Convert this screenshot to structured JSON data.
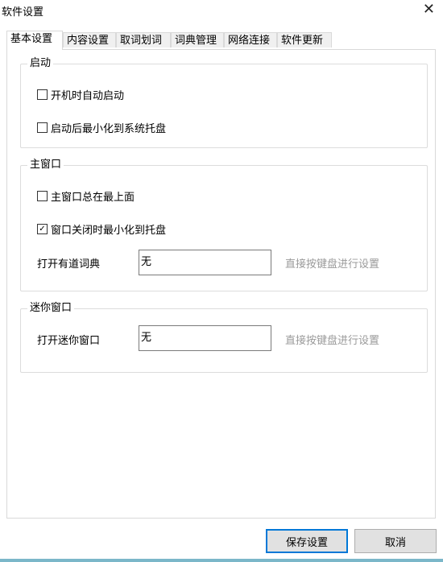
{
  "window": {
    "title": "软件设置"
  },
  "tabs": [
    {
      "label": "基本设置"
    },
    {
      "label": "内容设置"
    },
    {
      "label": "取词划词"
    },
    {
      "label": "词典管理"
    },
    {
      "label": "网络连接"
    },
    {
      "label": "软件更新"
    }
  ],
  "groups": {
    "startup": {
      "title": "启动",
      "options": [
        {
          "label": "开机时自动启动",
          "checked": false
        },
        {
          "label": "启动后最小化到系统托盘",
          "checked": false
        }
      ]
    },
    "main_window": {
      "title": "主窗口",
      "options": [
        {
          "label": "主窗口总在最上面",
          "checked": false
        },
        {
          "label": "窗口关闭时最小化到托盘",
          "checked": true
        }
      ],
      "hotkey": {
        "label": "打开有道词典",
        "value": "无",
        "hint": "直接按键盘进行设置"
      }
    },
    "mini_window": {
      "title": "迷你窗口",
      "hotkey": {
        "label": "打开迷你窗口",
        "value": "无",
        "hint": "直接按键盘进行设置"
      }
    }
  },
  "buttons": {
    "save": "保存设置",
    "cancel": "取消"
  },
  "icons": {
    "close": "close-icon",
    "check": "check-icon"
  },
  "colors": {
    "accent": "#0078d7",
    "border": "#d9d9d9",
    "hint": "#9a9a9a"
  }
}
